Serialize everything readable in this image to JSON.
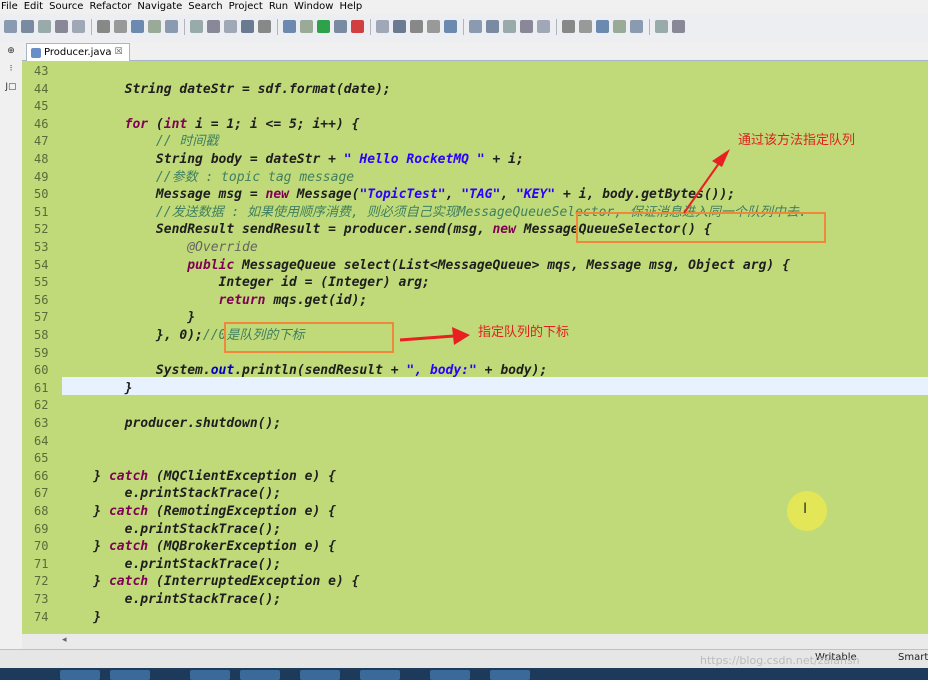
{
  "menu": [
    "File",
    "Edit",
    "Source",
    "Refactor",
    "Navigate",
    "Search",
    "Project",
    "Run",
    "Window",
    "Help"
  ],
  "tab": {
    "title": "Producer.java",
    "close": "☒"
  },
  "gutter_labels": [
    "⊕",
    "⁝",
    "J▢"
  ],
  "lines": [
    {
      "n": "43",
      "html": ""
    },
    {
      "n": "44",
      "html": "        String <i>dateStr</i> = sdf.format(date);"
    },
    {
      "n": "45",
      "html": ""
    },
    {
      "n": "46",
      "html": "        <span class=\"kw\">for</span> (<span class=\"kw\">int</span> i = 1; i &lt;= 5; i++) {"
    },
    {
      "n": "47",
      "html": "            <span class=\"cm\">// 时间戳</span>"
    },
    {
      "n": "48",
      "html": "            String body = dateStr + <span class=\"str\">\" Hello RocketMQ \"</span> + i;"
    },
    {
      "n": "49",
      "html": "            <span class=\"cm\">//参数 : topic tag message</span>"
    },
    {
      "n": "50",
      "html": "            Message msg = <span class=\"kw\">new</span> Message(<span class=\"str\">\"TopicTest\"</span>, <span class=\"str\">\"TAG\"</span>, <span class=\"str\">\"KEY\"</span> + i, body.getBytes());"
    },
    {
      "n": "51",
      "html": "            <span class=\"cm\">//发送数据 : 如果使用顺序消费, 则必须自己实现MessageQueueSelector, 保证消息进入同一个队列中去.</span>"
    },
    {
      "n": "52",
      "html": "            SendResult sendResult = producer.send(msg, <span class=\"kw\">new</span> MessageQueueSelector() {"
    },
    {
      "n": "53",
      "html": "                <span class=\"an\">@Override</span>"
    },
    {
      "n": "54",
      "html": "                <span class=\"kw\">public</span> MessageQueue select(List&lt;MessageQueue&gt; mqs, Message msg, Object arg) {"
    },
    {
      "n": "55",
      "html": "                    Integer id = (Integer) arg;"
    },
    {
      "n": "56",
      "html": "                    <span class=\"kw\">return</span> mqs.get(id);"
    },
    {
      "n": "57",
      "html": "                }"
    },
    {
      "n": "58",
      "html": "            }, 0);<span class=\"cm\">//0是队列的下标</span>"
    },
    {
      "n": "59",
      "html": ""
    },
    {
      "n": "60",
      "html": "            System.<span class=\"fd\">out</span>.println(sendResult + <span class=\"str\">\", body:\"</span> + body);"
    },
    {
      "n": "61",
      "html": "        }"
    },
    {
      "n": "62",
      "html": ""
    },
    {
      "n": "63",
      "html": "        producer.shutdown();"
    },
    {
      "n": "64",
      "html": ""
    },
    {
      "n": "65",
      "html": ""
    },
    {
      "n": "66",
      "html": "    } <span class=\"kw\">catch</span> (MQClientException e) {"
    },
    {
      "n": "67",
      "html": "        e.printStackTrace();"
    },
    {
      "n": "68",
      "html": "    } <span class=\"kw\">catch</span> (RemotingException e) {"
    },
    {
      "n": "69",
      "html": "        e.printStackTrace();"
    },
    {
      "n": "70",
      "html": "    } <span class=\"kw\">catch</span> (MQBrokerException e) {"
    },
    {
      "n": "71",
      "html": "        e.printStackTrace();"
    },
    {
      "n": "72",
      "html": "    } <span class=\"kw\">catch</span> (InterruptedException e) {"
    },
    {
      "n": "73",
      "html": "        e.printStackTrace();"
    },
    {
      "n": "74",
      "html": "    }"
    }
  ],
  "annotations": {
    "note_selector": "通过该方法指定队列",
    "note_index": "指定队列的下标"
  },
  "statusbar": {
    "writable": "Writable",
    "insert": "Smart"
  },
  "watermark": "https://blog.csdn.net/zalansh",
  "colors": {
    "editor_bg": "#c0da79",
    "annotation": "#e02020",
    "box": "#f0873a"
  }
}
